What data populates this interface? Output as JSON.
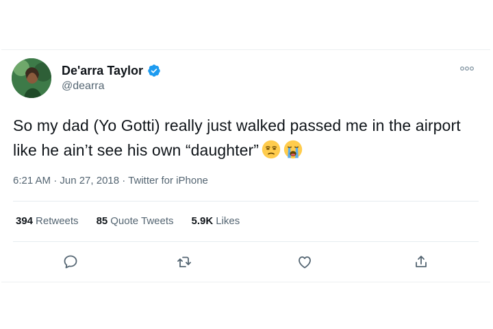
{
  "author": {
    "display_name": "De'arra Taylor",
    "handle": "@dearra",
    "verified": true
  },
  "tweet": {
    "text": "So my dad (Yo Gotti) really just walked passed me in the airport like he ain’t see his own “daughter”",
    "emojis": [
      "unamused-face-emoji",
      "loudly-crying-face-emoji"
    ],
    "timestamp": "6:21 AM · Jun 27, 2018 · Twitter for iPhone"
  },
  "stats": {
    "retweets_count": "394",
    "retweets_label": "Retweets",
    "quote_count": "85",
    "quote_label": "Quote Tweets",
    "likes_count": "5.9K",
    "likes_label": "Likes"
  },
  "actions": [
    "reply-icon",
    "retweet-icon",
    "like-icon",
    "share-icon"
  ],
  "colors": {
    "text": "#0f1419",
    "secondary": "#536471",
    "verified": "#1d9bf0",
    "divider": "#e6ecf0"
  }
}
